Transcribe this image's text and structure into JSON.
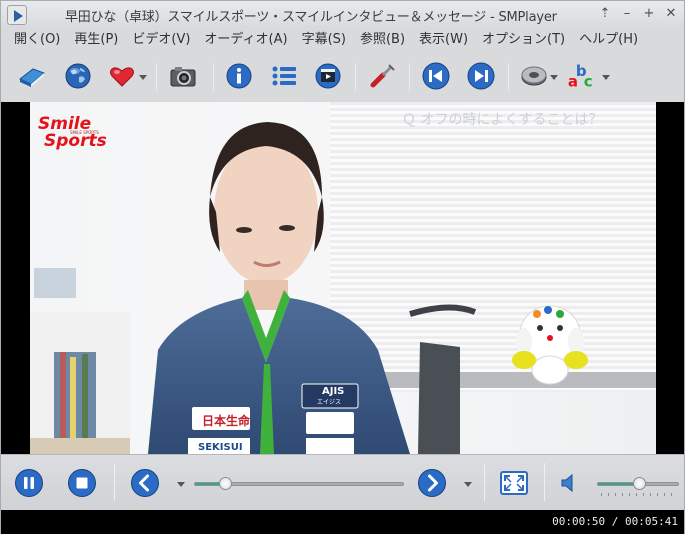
{
  "window": {
    "title": "早田ひな（卓球）スマイルスポーツ・スマイルインタビュー＆メッセージ - SMPlayer",
    "controls": {
      "keep_above": "⇡",
      "minimize": "–",
      "maximize": "+",
      "close": "✕"
    }
  },
  "menu": [
    {
      "label": "開く(O)"
    },
    {
      "label": "再生(P)"
    },
    {
      "label": "ビデオ(V)"
    },
    {
      "label": "オーディオ(A)"
    },
    {
      "label": "字幕(S)"
    },
    {
      "label": "参照(B)"
    },
    {
      "label": "表示(W)"
    },
    {
      "label": "オプション(T)"
    },
    {
      "label": "ヘルプ(H)"
    }
  ],
  "toolbar": {
    "icons": [
      "open-file-icon",
      "open-url-icon",
      "favorites-icon",
      "screenshot-icon",
      "info-icon",
      "playlist-icon",
      "media-info-icon",
      "preferences-icon",
      "previous-icon",
      "next-icon",
      "audio-track-icon",
      "subtitle-track-icon"
    ],
    "subtitle_icon_text": "abc"
  },
  "video": {
    "brand_line1": "Smile",
    "brand_line2": "Sports",
    "brand_tagline": "SMILE SPORTS",
    "subtitle": "Ｑ オフの時によくすることは？",
    "jersey_texts": [
      "日本生命",
      "AJIS",
      "エイジス",
      "SEKISUI"
    ]
  },
  "controls": {
    "icons": [
      "pause-icon",
      "stop-icon",
      "rewind-icon",
      "forward-icon",
      "fullscreen-icon",
      "volume-icon"
    ],
    "seek_fraction": 0.15,
    "volume_fraction": 0.52
  },
  "status": {
    "time": "00:00:50 / 00:05:41"
  },
  "colors": {
    "accent": "#39a38c",
    "brand_red": "#e3121b",
    "button_blue": "#2b6bc6"
  }
}
